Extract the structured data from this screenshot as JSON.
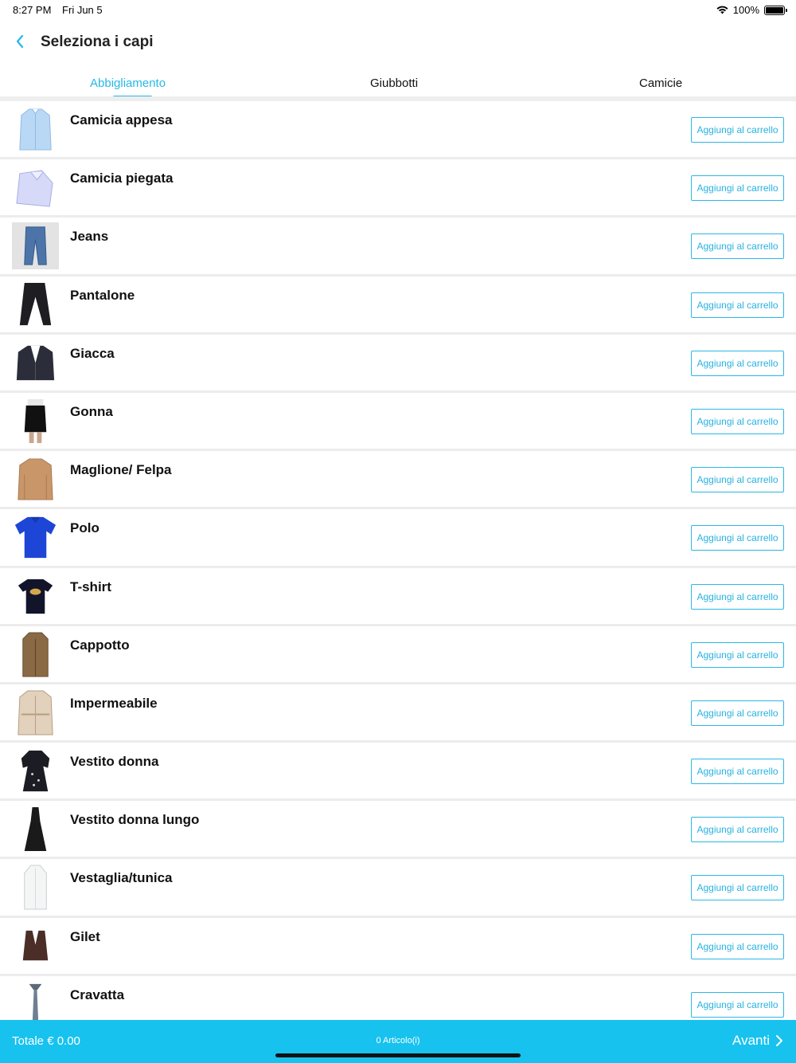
{
  "status_bar": {
    "time": "8:27 PM",
    "date": "Fri Jun 5",
    "battery": "100%"
  },
  "nav": {
    "title": "Seleziona i capi",
    "back_icon": "chevron-left-icon"
  },
  "tabs": [
    {
      "label": "Abbigliamento",
      "active": true
    },
    {
      "label": "Giubbotti",
      "active": false
    },
    {
      "label": "Camicie",
      "active": false
    }
  ],
  "items": [
    {
      "name": "Camicia appesa",
      "button": "Aggiungi al carrello",
      "icon": "hanging-shirt-icon"
    },
    {
      "name": "Camicia piegata",
      "button": "Aggiungi al carrello",
      "icon": "folded-shirt-icon"
    },
    {
      "name": "Jeans",
      "button": "Aggiungi al carrello",
      "icon": "jeans-icon"
    },
    {
      "name": "Pantalone",
      "button": "Aggiungi al carrello",
      "icon": "trousers-icon"
    },
    {
      "name": "Giacca",
      "button": "Aggiungi al carrello",
      "icon": "jacket-icon"
    },
    {
      "name": "Gonna",
      "button": "Aggiungi al carrello",
      "icon": "skirt-icon"
    },
    {
      "name": "Maglione/ Felpa",
      "button": "Aggiungi al carrello",
      "icon": "sweater-icon"
    },
    {
      "name": "Polo",
      "button": "Aggiungi al carrello",
      "icon": "polo-icon"
    },
    {
      "name": "T-shirt",
      "button": "Aggiungi al carrello",
      "icon": "tshirt-icon"
    },
    {
      "name": "Cappotto",
      "button": "Aggiungi al carrello",
      "icon": "coat-icon"
    },
    {
      "name": "Impermeabile",
      "button": "Aggiungi al carrello",
      "icon": "trench-coat-icon"
    },
    {
      "name": "Vestito donna",
      "button": "Aggiungi al carrello",
      "icon": "dress-icon"
    },
    {
      "name": "Vestito donna lungo",
      "button": "Aggiungi al carrello",
      "icon": "long-dress-icon"
    },
    {
      "name": "Vestaglia/tunica",
      "button": "Aggiungi al carrello",
      "icon": "tunic-icon"
    },
    {
      "name": "Gilet",
      "button": "Aggiungi al carrello",
      "icon": "vest-icon"
    },
    {
      "name": "Cravatta",
      "button": "Aggiungi al carrello",
      "icon": "tie-icon"
    }
  ],
  "footer": {
    "total": "Totale € 0.00",
    "count": "0 Articolo(i)",
    "next": "Avanti"
  },
  "colors": {
    "accent": "#27b8e6",
    "footer_bg": "#17c2ef"
  }
}
